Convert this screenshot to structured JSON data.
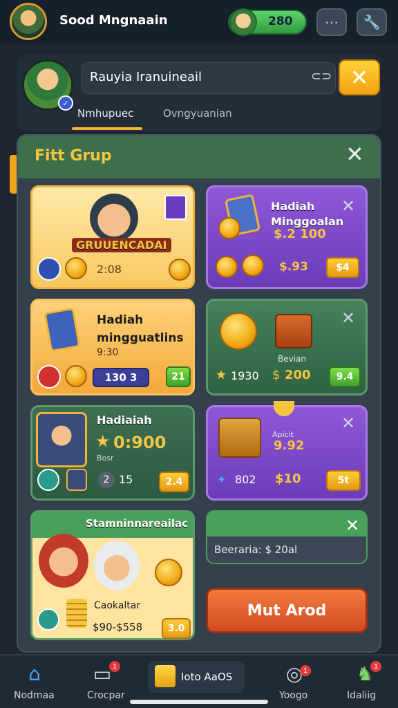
{
  "topbar": {
    "title": "Sood Mngnaain",
    "coins": "280",
    "avatar_icon": "player-avatar-icon",
    "chat_icon": "chat-icon",
    "settings_icon": "wrench-icon"
  },
  "profile": {
    "name": "Rauyia Iranuineail",
    "tabs": [
      "Nmhupuec",
      "Ovngyuanian"
    ]
  },
  "panel": {
    "title": "Fitt Grup",
    "cards": {
      "c1": {
        "banner": "GRUUENCADAI",
        "value": "2:08"
      },
      "c2": {
        "title": "Hadiah Minggoalan",
        "price": "$.2 100",
        "value": "$.93",
        "button": "$4"
      },
      "c3": {
        "title": "Hadiah mingguatlins",
        "sub": "9:30",
        "value": "130 3",
        "button": "21"
      },
      "c4": {
        "label": "Bevian",
        "stars": "1930",
        "coins": "200",
        "button": "9.4"
      },
      "c5": {
        "title": "Hadiaiah",
        "value": "0:900",
        "sub": "Bosr",
        "count1": "2",
        "count2": "15",
        "button": "2.4"
      },
      "c6": {
        "small": "Apicit",
        "price": "9.92",
        "left": "802",
        "right": "$10",
        "button": "5t"
      },
      "c7": {
        "header": "Stamninnareailac",
        "name": "Caokaltar",
        "price": "$90-$558",
        "button": "3.0"
      },
      "c8": {
        "text": "Beeraria: $ 20al"
      }
    },
    "action_button": "Mut Arod"
  },
  "bottom_nav": {
    "items": [
      "Nodmaa",
      "Crocpar",
      "Ioto AaOS",
      "Yoogo",
      "Idaliig"
    ],
    "badges": [
      "1",
      "1",
      "1"
    ]
  },
  "colors": {
    "accent": "#f2b531",
    "panel": "#34414c",
    "green_header": "#3d6f4a",
    "action": "#e2572c"
  }
}
